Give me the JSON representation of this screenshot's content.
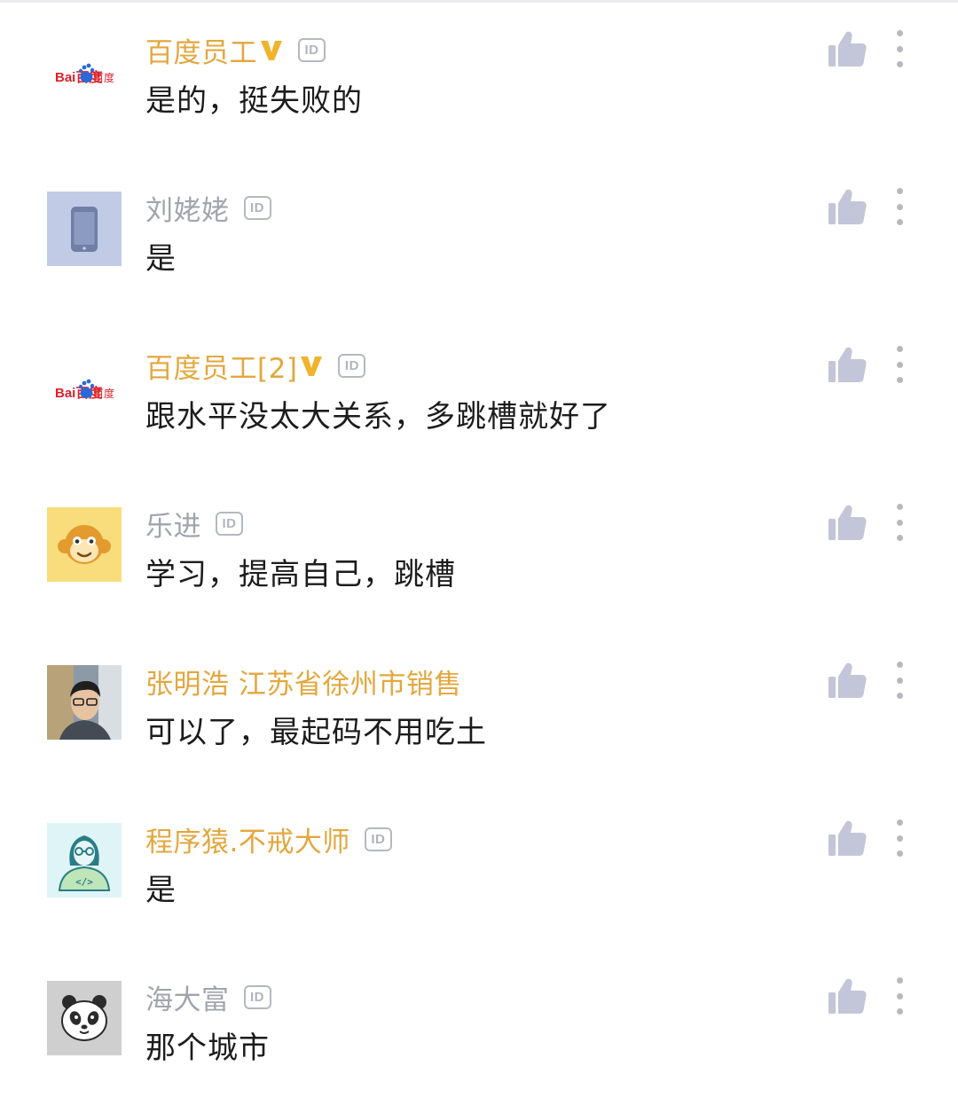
{
  "comments": [
    {
      "name": "百度员工",
      "verified": true,
      "id_badge": "ID",
      "text": "是的，挺失败的",
      "avatar": "baidu-logo",
      "avatar_text": "Bai百度",
      "name_color": "gold"
    },
    {
      "name": "刘姥姥",
      "verified": false,
      "id_badge": "ID",
      "text": "是",
      "avatar": "phone-icon",
      "name_color": "gray"
    },
    {
      "name": "百度员工[2]",
      "verified": true,
      "id_badge": "ID",
      "text": "跟水平没太大关系，多跳槽就好了",
      "avatar": "baidu-logo",
      "avatar_text": "Bai百度",
      "name_color": "gold"
    },
    {
      "name": "乐进",
      "verified": false,
      "id_badge": "ID",
      "text": "学习，提高自己，跳槽",
      "avatar": "monkey-avatar",
      "name_color": "gray"
    },
    {
      "name": "张明浩 江苏省徐州市销售",
      "verified": false,
      "id_badge": "",
      "text": "可以了，最起码不用吃土",
      "avatar": "person-photo",
      "name_color": "gold"
    },
    {
      "name": "程序猿.不戒大师",
      "verified": false,
      "id_badge": "ID",
      "text": "是",
      "avatar": "coder-avatar",
      "avatar_text": "</>",
      "name_color": "gold"
    },
    {
      "name": "海大富",
      "verified": false,
      "id_badge": "ID",
      "text": "那个城市",
      "avatar": "panda-avatar",
      "name_color": "gray"
    }
  ],
  "colors": {
    "gold": "#e3a73e",
    "gray": "#a1a4ad",
    "icon": "#c3c6d8"
  }
}
